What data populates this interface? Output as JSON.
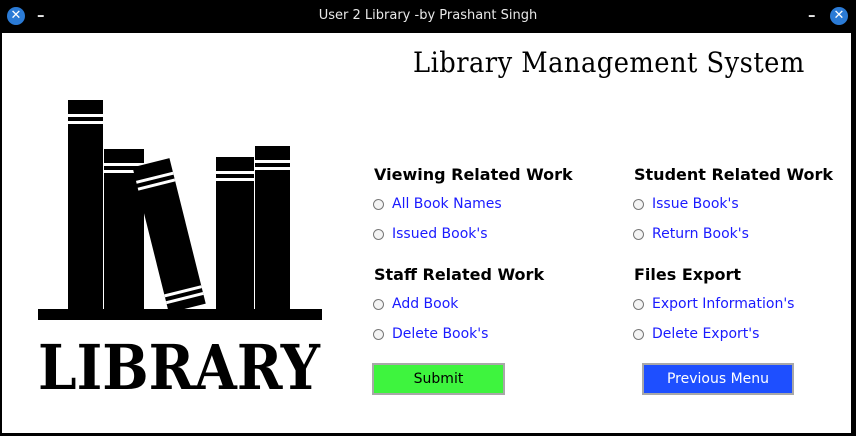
{
  "window": {
    "title": "User 2 Library -by Prashant Singh",
    "close_glyph": "✕",
    "min_glyph": "–"
  },
  "app": {
    "title": "Library Management System",
    "logo_text": "LIBRARY"
  },
  "sections": {
    "viewing": {
      "title": "Viewing Related Work",
      "options": [
        "All Book Names",
        "Issued Book's"
      ]
    },
    "student": {
      "title": "Student Related Work",
      "options": [
        "Issue Book's",
        "Return Book's"
      ]
    },
    "staff": {
      "title": "Staff Related Work",
      "options": [
        "Add Book",
        "Delete Book's"
      ]
    },
    "files": {
      "title": "Files Export",
      "options": [
        "Export Information's",
        "Delete Export's"
      ]
    }
  },
  "buttons": {
    "submit": "Submit",
    "previous": "Previous Menu"
  },
  "colors": {
    "option_text": "#1a1aff",
    "submit_bg": "#3ef43e",
    "previous_bg": "#1e4fff"
  }
}
